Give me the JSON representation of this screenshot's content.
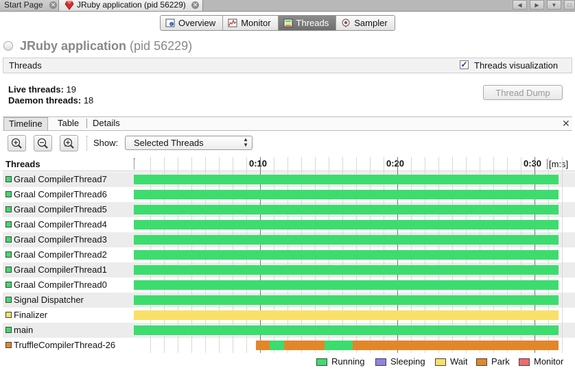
{
  "window": {
    "tabs": [
      {
        "label": "Start Page",
        "active": false
      },
      {
        "label": "JRuby application (pid 56229)",
        "active": true
      }
    ]
  },
  "views": [
    {
      "label": "Overview",
      "icon": "overview-icon",
      "selected": false
    },
    {
      "label": "Monitor",
      "icon": "monitor-icon",
      "selected": false
    },
    {
      "label": "Threads",
      "icon": "threads-icon",
      "selected": true
    },
    {
      "label": "Sampler",
      "icon": "sampler-icon",
      "selected": false
    }
  ],
  "header": {
    "app_name": "JRuby application",
    "pid": "(pid 56229)",
    "section_label": "Threads",
    "visualization_label": "Threads visualization",
    "visualization_checked": true
  },
  "stats": {
    "live_label": "Live threads:",
    "live_value": "19",
    "daemon_label": "Daemon threads:",
    "daemon_value": "18",
    "dump_button": "Thread Dump"
  },
  "subtabs": [
    {
      "label": "Timeline",
      "selected": true
    },
    {
      "label": "Table",
      "selected": false
    },
    {
      "label": "Details",
      "selected": false
    }
  ],
  "toolbar": {
    "show_label": "Show:",
    "show_value": "Selected Threads"
  },
  "timeline": {
    "column_label": "Threads",
    "ticks": [
      "0:10",
      "0:20",
      "0:30"
    ],
    "unit": "[m:s]"
  },
  "states": {
    "running": {
      "label": "Running",
      "color": "#3ddc6e"
    },
    "sleeping": {
      "label": "Sleeping",
      "color": "#8f83e3"
    },
    "wait": {
      "label": "Wait",
      "color": "#f9e069"
    },
    "park": {
      "label": "Park",
      "color": "#e2862a"
    },
    "monitor": {
      "label": "Monitor",
      "color": "#f06b6b"
    }
  },
  "legend_order": [
    "running",
    "sleeping",
    "wait",
    "park",
    "monitor"
  ],
  "threads": [
    {
      "name": "Graal CompilerThread7",
      "state": "running"
    },
    {
      "name": "Graal CompilerThread6",
      "state": "running"
    },
    {
      "name": "Graal CompilerThread5",
      "state": "running"
    },
    {
      "name": "Graal CompilerThread4",
      "state": "running"
    },
    {
      "name": "Graal CompilerThread3",
      "state": "running"
    },
    {
      "name": "Graal CompilerThread2",
      "state": "running"
    },
    {
      "name": "Graal CompilerThread1",
      "state": "running"
    },
    {
      "name": "Graal CompilerThread0",
      "state": "running"
    },
    {
      "name": "Signal Dispatcher",
      "state": "running"
    },
    {
      "name": "Finalizer",
      "state": "wait"
    },
    {
      "name": "main",
      "state": "running"
    },
    {
      "name": "TruffleCompilerThread-26",
      "state": "park"
    }
  ]
}
